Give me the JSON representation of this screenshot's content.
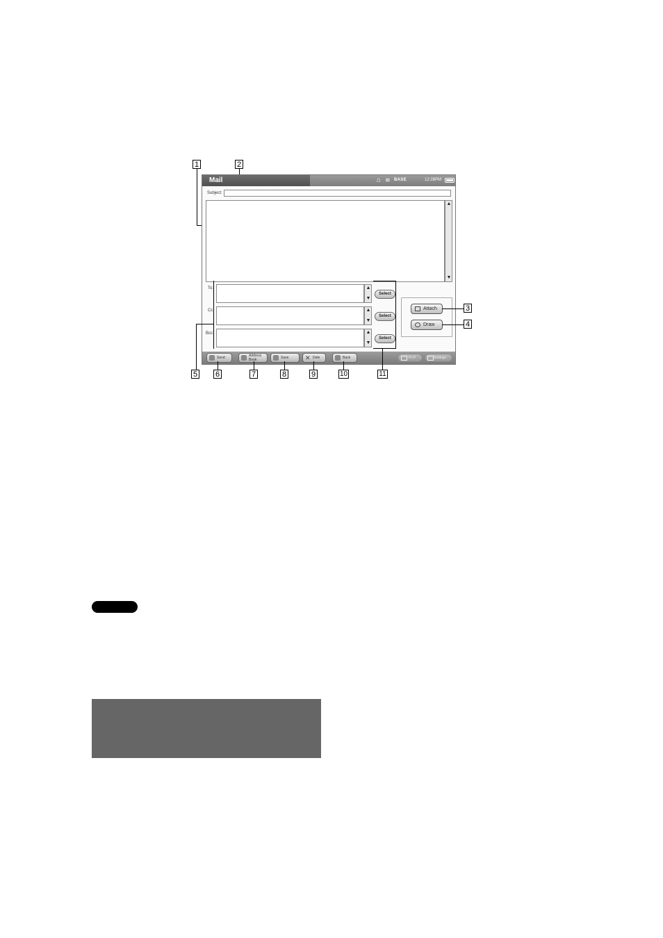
{
  "screen": {
    "title": "Mail",
    "status": {
      "base_label": "BASE",
      "clock": "12:28PM"
    },
    "subject_label": "Subject:",
    "recipients": [
      {
        "label": "To:",
        "select_label": "Select"
      },
      {
        "label": "Cc:",
        "select_label": "Select"
      },
      {
        "label": "Bcc:",
        "select_label": "Select"
      }
    ],
    "side_buttons": {
      "attach": "Attach",
      "draw": "Draw"
    },
    "bottom_bar": {
      "send": "Send",
      "address_book": "Address Book",
      "save": "Save",
      "delete": "Dele",
      "back": "Back",
      "pip": "P.I.P",
      "settings": "Settings"
    }
  },
  "callouts": [
    "1",
    "2",
    "3",
    "4",
    "5",
    "6",
    "7",
    "8",
    "9",
    "10",
    "11"
  ],
  "colors": {
    "title_bar": "#505050",
    "bottom_bar": "#8a8a8a",
    "gray_block": "#666666",
    "note_badge": "#000000"
  },
  "icons": [
    "home-icon",
    "wifi-icon",
    "battery-icon",
    "send-icon",
    "address-book-icon",
    "save-icon",
    "delete-icon",
    "back-icon",
    "pip-icon",
    "settings-icon",
    "attach-icon",
    "draw-icon"
  ]
}
